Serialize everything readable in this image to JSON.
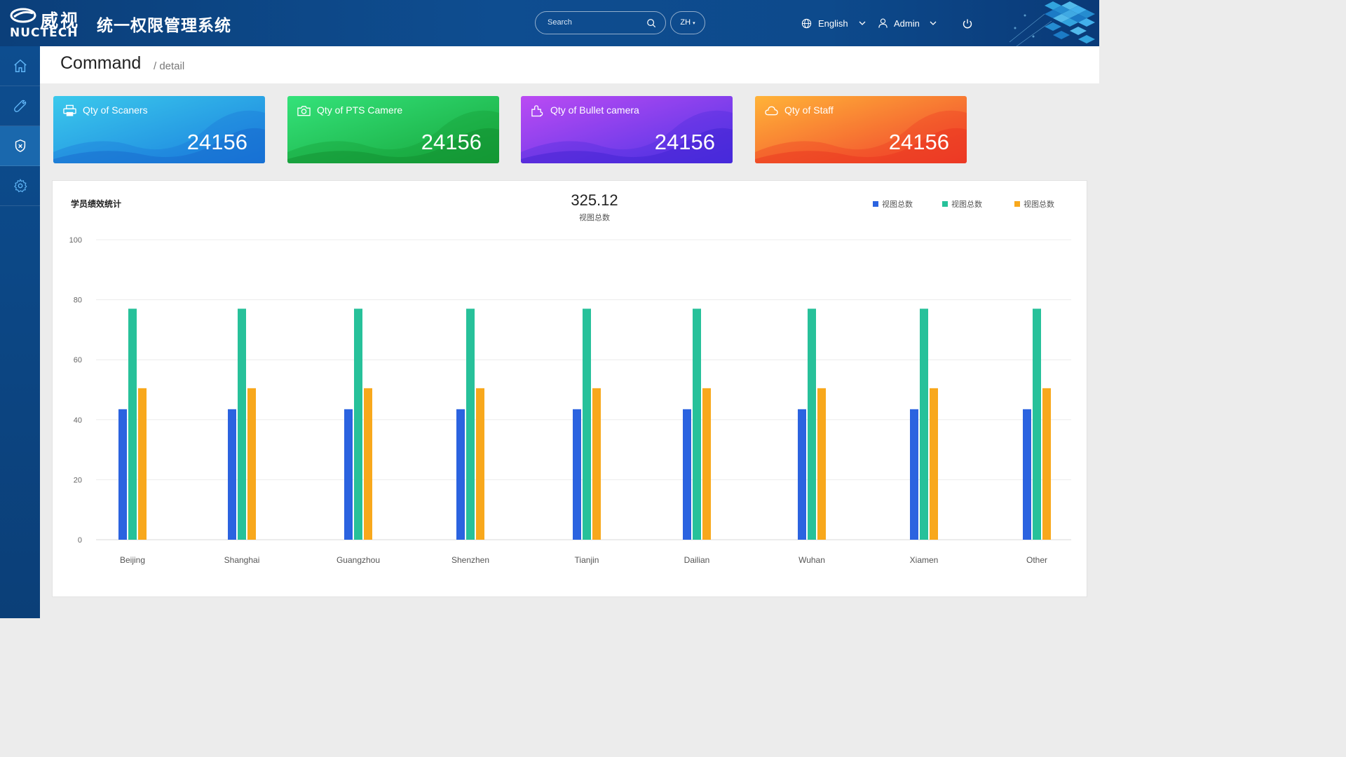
{
  "header": {
    "logo_cn": "威视",
    "logo_en": "NUCTECH",
    "app_title": "统一权限管理系统",
    "search_placeholder": "Search",
    "lang_pill": "ZH",
    "language": "English",
    "user": "Admin"
  },
  "sidebar": {
    "items": [
      {
        "icon": "home-icon",
        "active": false
      },
      {
        "icon": "tools-icon",
        "active": false
      },
      {
        "icon": "shield-icon",
        "active": true
      },
      {
        "icon": "gear-icon",
        "active": false
      }
    ]
  },
  "page": {
    "title": "Command",
    "breadcrumb": "/ detail"
  },
  "cards": [
    {
      "label": "Qty of Scaners",
      "value": "24156",
      "icon": "printer-icon",
      "color_from": "#39c7ea",
      "color_to": "#1d86e0"
    },
    {
      "label": "Qty of PTS Camere",
      "value": "24156",
      "icon": "camera-icon",
      "color_from": "#2ee07a",
      "color_to": "#18a83a"
    },
    {
      "label": "Qty of Bullet camera",
      "value": "24156",
      "icon": "puzzle-icon",
      "color_from": "#b94af2",
      "color_to": "#5a32e6"
    },
    {
      "label": "Qty of Staff",
      "value": "24156",
      "icon": "cloud-icon",
      "color_from": "#ffb236",
      "color_to": "#f0382c"
    }
  ],
  "panel": {
    "title": "学员绩效统计",
    "kpi_value": "325.12",
    "kpi_label": "视图总数"
  },
  "chart_data": {
    "type": "bar",
    "categories": [
      "Beijing",
      "Shanghai",
      "Guangzhou",
      "Shenzhen",
      "Tianjin",
      "Dailian",
      "Wuhan",
      "Xiamen",
      "Other"
    ],
    "series": [
      {
        "name": "视图总数",
        "color": "#2b63e0",
        "values": [
          43.5,
          43.5,
          43.5,
          43.5,
          43.5,
          43.5,
          43.5,
          43.5,
          43.5
        ]
      },
      {
        "name": "视图总数",
        "color": "#27c19a",
        "values": [
          77,
          77,
          77,
          77,
          77,
          77,
          77,
          77,
          77
        ]
      },
      {
        "name": "视图总数",
        "color": "#f8a81c",
        "values": [
          50.5,
          50.5,
          50.5,
          50.5,
          50.5,
          50.5,
          50.5,
          50.5,
          50.5
        ]
      }
    ],
    "yticks": [
      0,
      20,
      40,
      60,
      80,
      100
    ],
    "ylim": [
      0,
      100
    ],
    "legend_position": "top-right",
    "grid": true
  }
}
